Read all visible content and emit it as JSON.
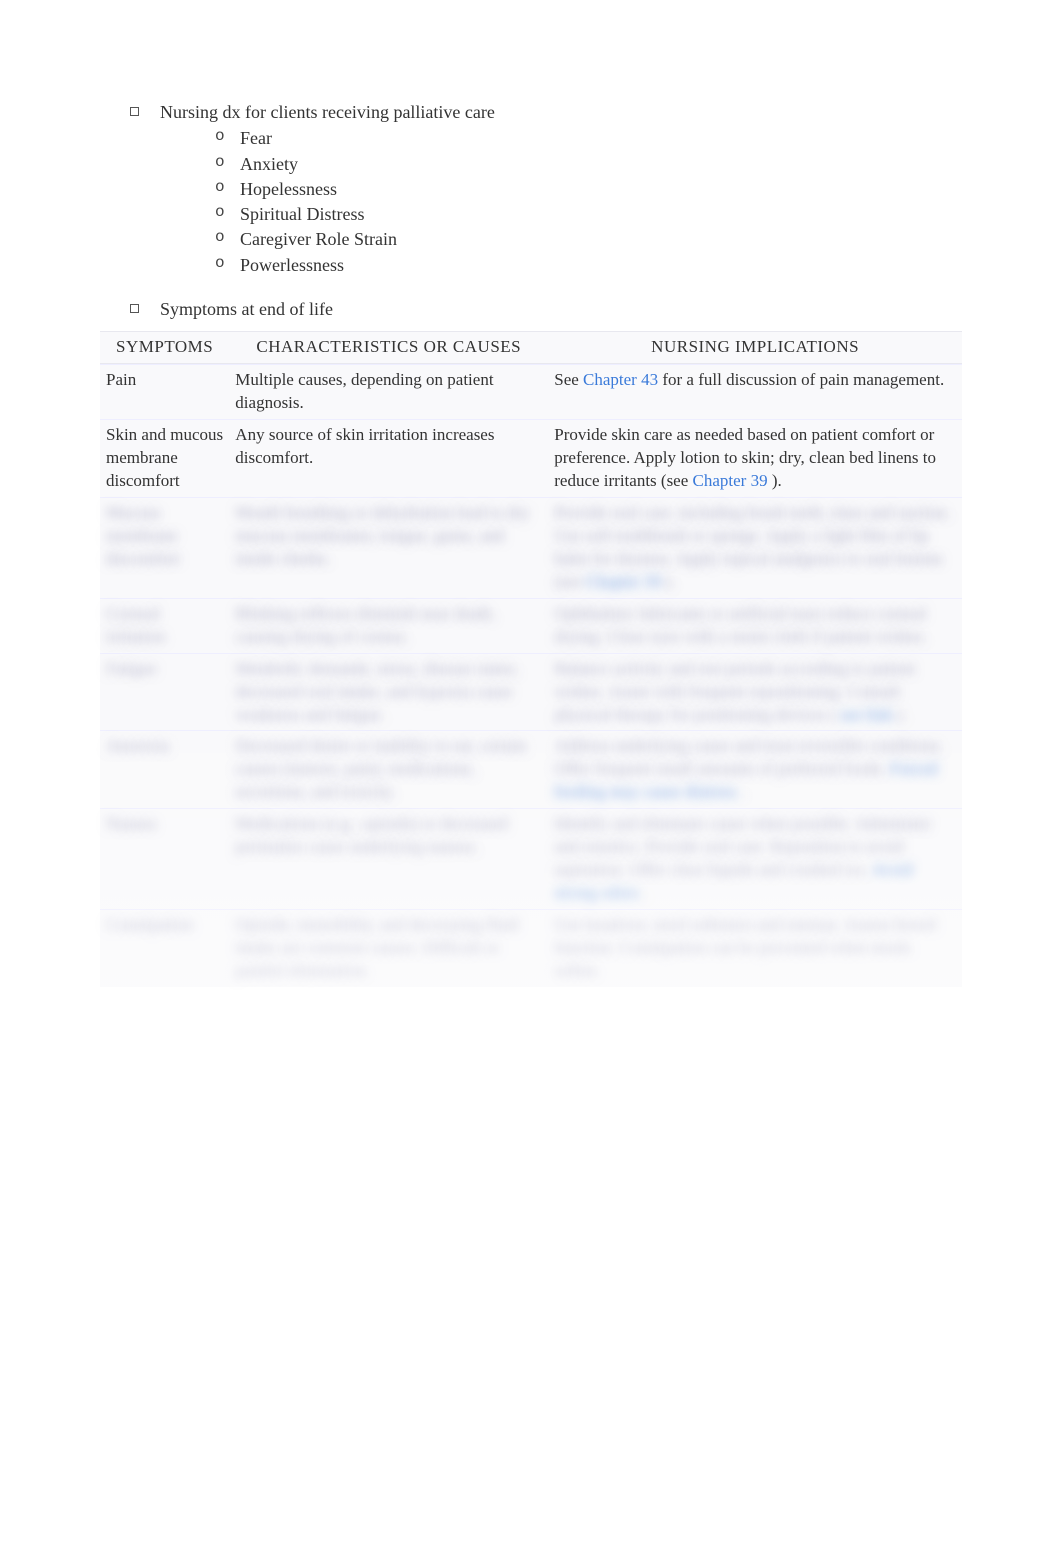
{
  "outline": {
    "item1": {
      "label": "Nursing dx for clients receiving palliative care",
      "subs": [
        "Fear",
        "Anxiety",
        "Hopelessness",
        "Spiritual Distress",
        "Caregiver Role Strain",
        "Powerlessness"
      ]
    },
    "item2": {
      "label": "Symptoms at end of life"
    }
  },
  "table": {
    "headers": {
      "symptoms": "SYMPTOMS",
      "char": "CHARACTERISTICS OR CAUSES",
      "nursing": "NURSING IMPLICATIONS"
    },
    "rows": [
      {
        "symptom": "Pain",
        "char": "Multiple causes, depending on patient diagnosis.",
        "nursing_pre": "See ",
        "nursing_link": "Chapter 43",
        "nursing_post": " for a full discussion of pain management."
      },
      {
        "symptom": "Skin and mucous membrane discomfort",
        "char": "Any source of skin irritation increases discomfort.",
        "nursing_pre": "Provide skin care as needed based on patient comfort or preference. Apply lotion to skin; dry, clean bed linens to reduce irritants (see ",
        "nursing_link": "Chapter 39",
        "nursing_post": ")."
      }
    ],
    "blurred_rows": [
      {
        "symptom": "Mucous membrane discomfort",
        "char": "Mouth breathing or dehydration lead to dry mucous membranes; tongue, gums, and inside cheeks.",
        "nursing_pre": "Provide oral care, including brush teeth, rinse and suction. Use soft toothbrush or sponge. Apply a light film of lip balm for dryness. Apply topical analgesics to oral lesions (see ",
        "nursing_link": "Chapter 39",
        "nursing_post": ")."
      },
      {
        "symptom": "Corneal irritation",
        "char": "Blinking reflexes diminish near death, causing drying of cornea.",
        "nursing_pre": "Ophthalmic lubricants or artificial tears reduce corneal drying. Close eyes with a moist cloth if patient wishes.",
        "nursing_link": "",
        "nursing_post": ""
      },
      {
        "symptom": "Fatigue",
        "char": "Metabolic demands, stress, disease states, decreased oral intake, and hypoxia cause weakness and fatigue.",
        "nursing_pre": "Balance activity and rest periods according to patient wishes. Assist with frequent repositioning. Consult physical therapy for positioning devices (",
        "nursing_link": "see link",
        "nursing_post": ")."
      },
      {
        "symptom": "Anorexia",
        "char": "Decreased desire or inability to eat, certain causes (tumors, pain), medications, secretions, and toxicity.",
        "nursing_pre": "Address underlying cause and treat reversible conditions. Offer frequent small amounts of preferred foods.",
        "nursing_link": "Forced feeding may cause distress",
        "nursing_post": "."
      },
      {
        "symptom": "Nausea",
        "char": "Medications (e.g., opioids) or decreased peristalsis cause underlying nausea.",
        "nursing_pre": "Identify and eliminate cause when possible. Administer anti-emetics. Provide oral care. Reposition to avoid aspiration. Offer clear liquids and crushed ice.",
        "nursing_link": "Avoid strong odors",
        "nursing_post": "."
      },
      {
        "symptom": "Constipation",
        "char": "Opioids, immobility, and decreasing fluid intake are common causes. Difficult or painful elimination.",
        "nursing_pre": "Use laxatives, stool softeners and enemas. Assess bowel function. Constipation can be prevented when stools soften.",
        "nursing_link": "",
        "nursing_post": ""
      }
    ]
  }
}
